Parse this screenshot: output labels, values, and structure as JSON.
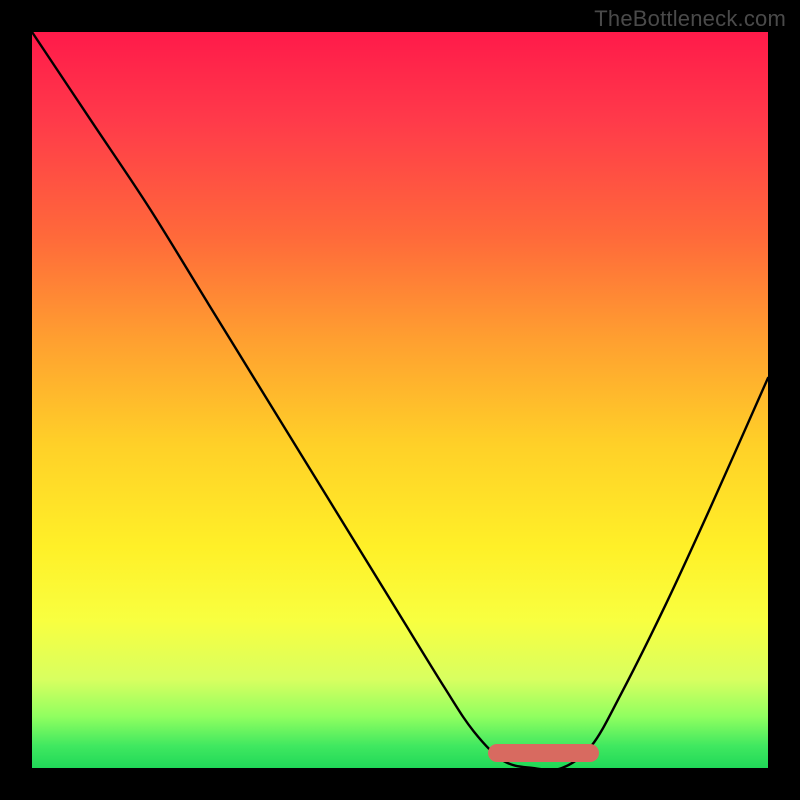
{
  "watermark": "TheBottleneck.com",
  "chart_data": {
    "type": "line",
    "title": "",
    "xlabel": "",
    "ylabel": "",
    "xlim": [
      0,
      100
    ],
    "ylim": [
      0,
      100
    ],
    "background_gradient": {
      "top": "#ff1a4a",
      "bottom": "#20d858"
    },
    "series": [
      {
        "name": "bottleneck-curve",
        "x": [
          0,
          8,
          16,
          24,
          32,
          40,
          48,
          56,
          60,
          64,
          68,
          72,
          76,
          80,
          86,
          92,
          100
        ],
        "values": [
          100,
          88,
          76,
          63,
          50,
          37,
          24,
          11,
          5,
          1,
          0,
          0,
          3,
          10,
          22,
          35,
          53
        ]
      }
    ],
    "annotations": [
      {
        "name": "optimal-range-marker",
        "x_start": 62,
        "x_end": 77,
        "color": "#d86a60"
      }
    ]
  }
}
